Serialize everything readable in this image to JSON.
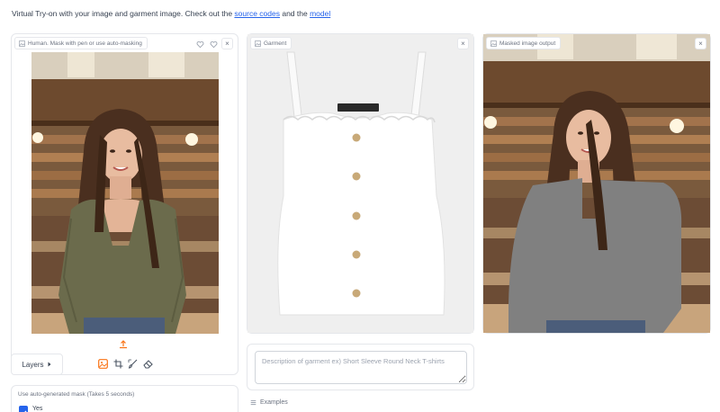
{
  "intro": {
    "prefix": "Virtual Try-on with your image and garment image. Check out the ",
    "link1": "source codes",
    "middle": " and the ",
    "link2": "model"
  },
  "human_panel": {
    "label": "Human. Mask with pen or use auto-masking",
    "upload_icon": "upload-icon",
    "layers_label": "Layers",
    "tools": [
      "image-tool-icon",
      "crop-icon",
      "brush-icon",
      "eraser-icon"
    ]
  },
  "garment_panel": {
    "label": "Garment",
    "description_placeholder": "Description of garment ex) Short Sleeve Round Neck T-shirts"
  },
  "output_panel": {
    "label": "Masked image output"
  },
  "auto_mask": {
    "label": "Use auto-generated mask (Takes 5 seconds)",
    "option": "Yes",
    "checked": true
  },
  "examples": {
    "label": "Examples"
  },
  "colors": {
    "accent": "#2563eb",
    "mask_gray": "#808080",
    "border": "#e5e7eb"
  }
}
